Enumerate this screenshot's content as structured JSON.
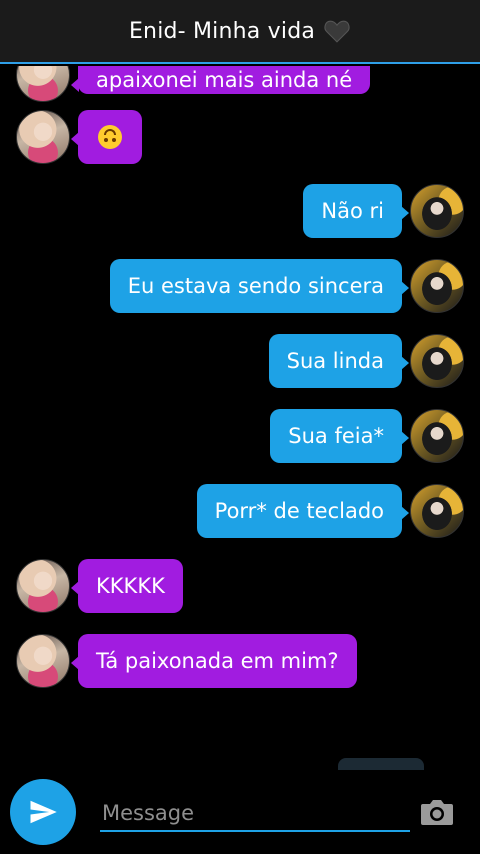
{
  "header": {
    "title": "Enid- Minha vida",
    "icon": "black-heart-icon"
  },
  "messages": [
    {
      "side": "left",
      "sender": "enid",
      "text": "apaixonei mais ainda né",
      "partial": true
    },
    {
      "side": "left",
      "sender": "enid",
      "text": "",
      "icon": "upside-down-face-emoji"
    },
    {
      "side": "right",
      "sender": "wednesday",
      "text": "Não ri"
    },
    {
      "side": "right",
      "sender": "wednesday",
      "text": "Eu estava sendo sincera"
    },
    {
      "side": "right",
      "sender": "wednesday",
      "text": "Sua linda"
    },
    {
      "side": "right",
      "sender": "wednesday",
      "text": "Sua feia*"
    },
    {
      "side": "right",
      "sender": "wednesday",
      "text": "Porr* de teclado"
    },
    {
      "side": "left",
      "sender": "enid",
      "text": "KKKKK"
    },
    {
      "side": "left",
      "sender": "enid",
      "text": "Tá paixonada em mim?"
    }
  ],
  "composer": {
    "placeholder": "Message",
    "send_icon": "send-icon",
    "camera_icon": "camera-icon"
  },
  "colors": {
    "header_bg": "#1b1b1b",
    "accent": "#1ea2e6",
    "enid_bubble": "#a11ce0",
    "wednesday_bubble": "#1ea2e6"
  }
}
